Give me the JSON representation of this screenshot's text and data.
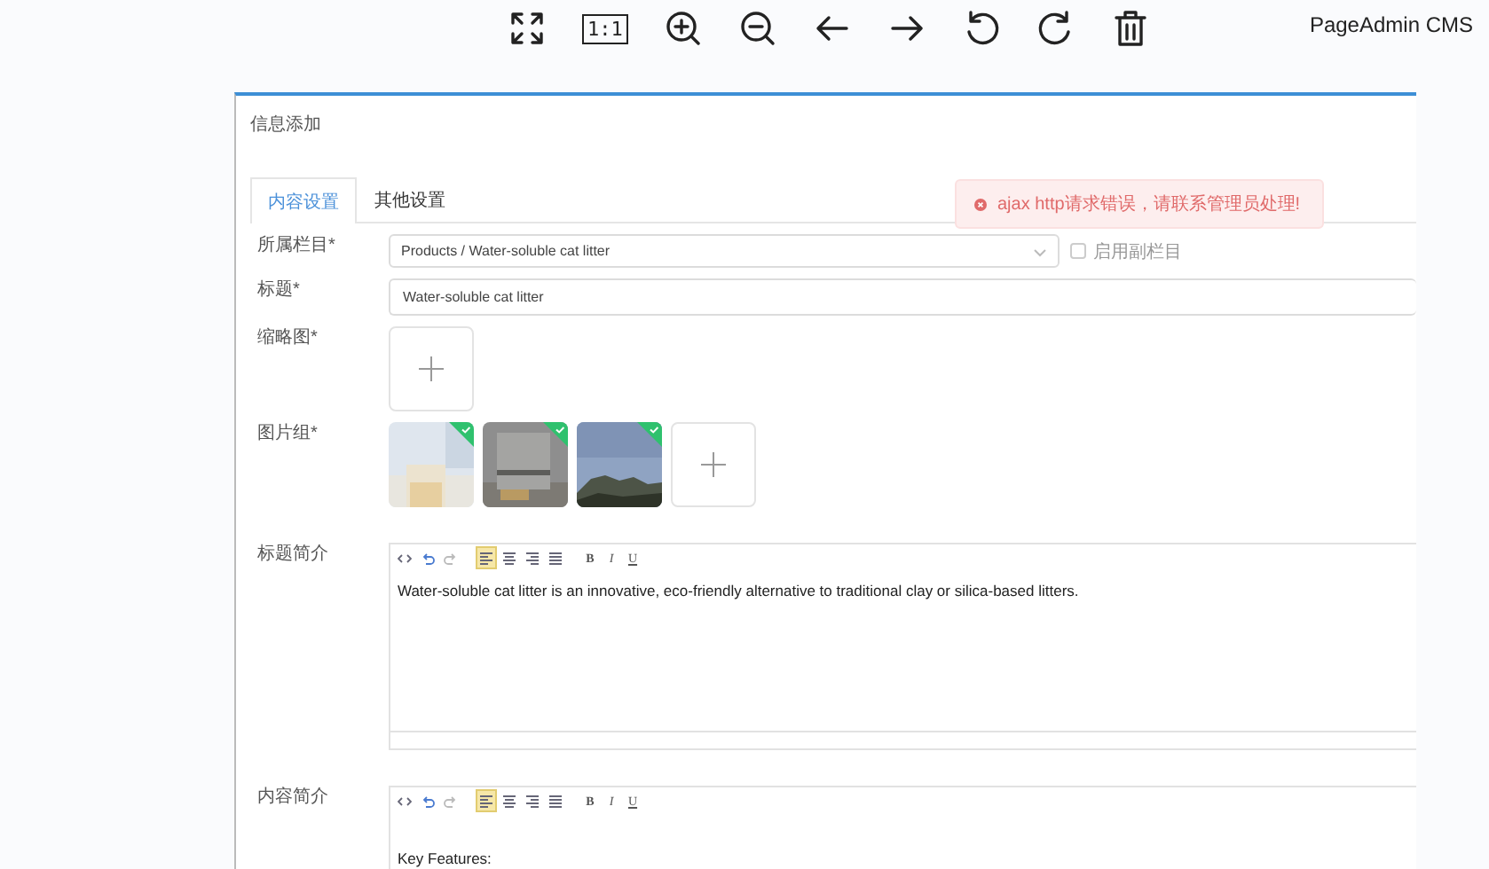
{
  "viewer_toolbar": {
    "buttons": [
      {
        "kind": "fullscreen"
      },
      {
        "kind": "actual-size",
        "label": "1:1"
      },
      {
        "kind": "zoom-in"
      },
      {
        "kind": "zoom-out"
      },
      {
        "kind": "previous"
      },
      {
        "kind": "next"
      },
      {
        "kind": "rotate-left"
      },
      {
        "kind": "rotate-right"
      },
      {
        "kind": "delete"
      }
    ]
  },
  "app_name": "PageAdmin CMS",
  "image": {
    "page_title": "信息添加",
    "tabs": [
      {
        "label": "内容设置",
        "selected": true
      },
      {
        "label": "其他设置",
        "selected": false
      }
    ],
    "toast": {
      "kind": "error",
      "text": "ajax http请求错误，请联系管理员处理!"
    },
    "fields": [
      {
        "kind": "select",
        "label": "所属栏目*",
        "value": "Products / Water-soluble cat litter",
        "checkbox": {
          "label": "启用副栏目",
          "checked": false
        }
      },
      {
        "kind": "text",
        "label": "标题*",
        "value": "Water-soluble cat litter"
      },
      {
        "kind": "upload",
        "label": "缩略图*"
      },
      {
        "kind": "gallery",
        "label": "图片组*",
        "images": [
          {
            "uploaded": true
          },
          {
            "uploaded": true
          },
          {
            "uploaded": true
          }
        ]
      },
      {
        "kind": "editor",
        "label": "标题简介",
        "text": "Water-soluble cat litter is an innovative, eco-friendly alternative to traditional clay or silica-based litters.",
        "toolbar": [
          {
            "kind": "source"
          },
          {
            "kind": "undo"
          },
          {
            "kind": "redo"
          },
          {
            "kind": "align-left",
            "active": true
          },
          {
            "kind": "align-center",
            "active": false
          },
          {
            "kind": "align-right",
            "active": false
          },
          {
            "kind": "justify",
            "active": false
          },
          {
            "kind": "bold",
            "label": "B"
          },
          {
            "kind": "italic",
            "label": "I"
          },
          {
            "kind": "underline",
            "label": "U"
          }
        ]
      },
      {
        "kind": "editor",
        "label": "内容简介",
        "text": "Key Features:",
        "toolbar": [
          {
            "kind": "source"
          },
          {
            "kind": "undo"
          },
          {
            "kind": "redo"
          },
          {
            "kind": "align-left",
            "active": true
          },
          {
            "kind": "align-center",
            "active": false
          },
          {
            "kind": "align-right",
            "active": false
          },
          {
            "kind": "justify",
            "active": false
          },
          {
            "kind": "bold",
            "label": "B"
          },
          {
            "kind": "italic",
            "label": "I"
          },
          {
            "kind": "underline",
            "label": "U"
          }
        ]
      }
    ]
  }
}
